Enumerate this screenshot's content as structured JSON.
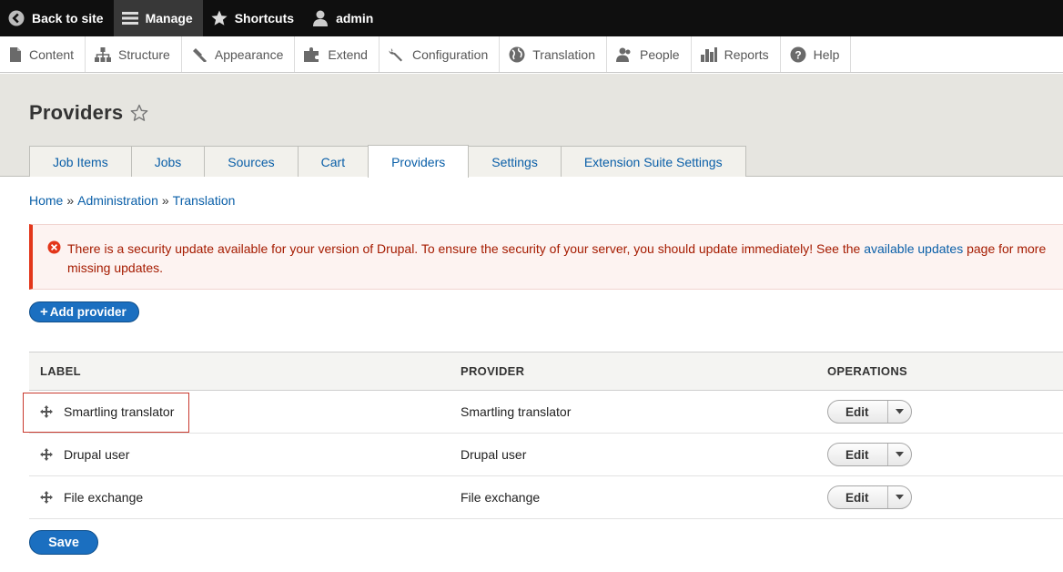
{
  "toolbar": {
    "items": [
      {
        "label": "Back to site",
        "icon": "back-arrow-circle-icon"
      },
      {
        "label": "Manage",
        "icon": "hamburger-menu-icon"
      },
      {
        "label": "Shortcuts",
        "icon": "star-icon"
      },
      {
        "label": "admin",
        "icon": "user-icon"
      }
    ]
  },
  "tray": {
    "items": [
      {
        "label": "Content",
        "icon": "file-icon"
      },
      {
        "label": "Structure",
        "icon": "sitemap-icon"
      },
      {
        "label": "Appearance",
        "icon": "paintbrush-icon"
      },
      {
        "label": "Extend",
        "icon": "puzzle-icon"
      },
      {
        "label": "Configuration",
        "icon": "wrench-icon"
      },
      {
        "label": "Translation",
        "icon": "globe-icon"
      },
      {
        "label": "People",
        "icon": "people-icon"
      },
      {
        "label": "Reports",
        "icon": "bar-chart-icon"
      },
      {
        "label": "Help",
        "icon": "help-icon"
      }
    ]
  },
  "page": {
    "title": "Providers",
    "tabs": [
      {
        "label": "Job Items",
        "active": false
      },
      {
        "label": "Jobs",
        "active": false
      },
      {
        "label": "Sources",
        "active": false
      },
      {
        "label": "Cart",
        "active": false
      },
      {
        "label": "Providers",
        "active": true
      },
      {
        "label": "Settings",
        "active": false
      },
      {
        "label": "Extension Suite Settings",
        "active": false
      }
    ]
  },
  "breadcrumb": {
    "items": [
      "Home",
      "Administration",
      "Translation"
    ],
    "separator": "»"
  },
  "message": {
    "text_before": "There is a security update available for your version of Drupal. To ensure the security of your server, you should update immediately! See the ",
    "link": "available updates",
    "text_after": " page for more",
    "line2": "missing updates."
  },
  "actions": {
    "add_provider": "Add provider",
    "save": "Save"
  },
  "table": {
    "headers": {
      "label": "LABEL",
      "provider": "PROVIDER",
      "operations": "OPERATIONS"
    },
    "rows": [
      {
        "label": "Smartling translator",
        "provider": "Smartling translator",
        "op": "Edit"
      },
      {
        "label": "Drupal user",
        "provider": "Drupal user",
        "op": "Edit"
      },
      {
        "label": "File exchange",
        "provider": "File exchange",
        "op": "Edit"
      }
    ]
  },
  "colors": {
    "toolbar": "#0f0f0f",
    "link": "#0a5fa8",
    "error_text": "#a51b00",
    "error_border": "#e3361a",
    "primary_button": "#1b6fc0"
  }
}
